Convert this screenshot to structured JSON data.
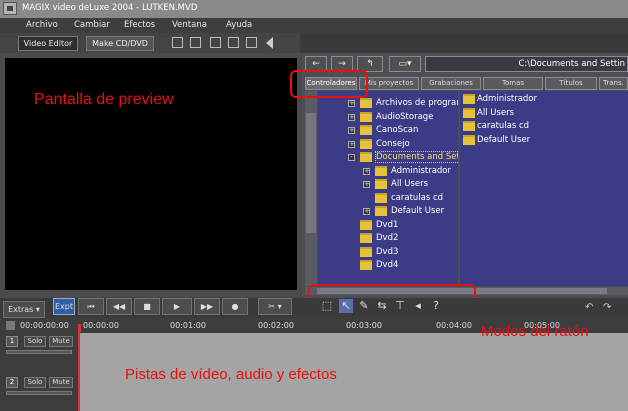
{
  "window": {
    "title": "MAGIX video deLuxe 2004 - LUTKEN.MVD"
  },
  "menu": [
    "Archivo",
    "Cambiar",
    "Efectos",
    "Ventana",
    "Ayuda"
  ],
  "toolbar": {
    "video_editor_tab": "Video Editor",
    "make_cd_tab": "Make CD/DVD"
  },
  "browser": {
    "path": "C:\\Documents and Settin",
    "tabs": [
      "Controladores",
      "Mis proyectos",
      "Grabaciones",
      "Tomas",
      "Títulos",
      "Trans."
    ],
    "tree": [
      {
        "label": "Archivos de program",
        "level": 1,
        "expander": "+"
      },
      {
        "label": "AudioStorage",
        "level": 1,
        "expander": "+"
      },
      {
        "label": "CanoScan",
        "level": 1,
        "expander": "+"
      },
      {
        "label": "Consejo",
        "level": 1,
        "expander": "+"
      },
      {
        "label": "Documents and Sett",
        "level": 1,
        "expander": "-",
        "selected": true
      },
      {
        "label": "Administrador",
        "level": 2,
        "expander": "+"
      },
      {
        "label": "All Users",
        "level": 2,
        "expander": "+"
      },
      {
        "label": "caratulas cd",
        "level": 2,
        "expander": ""
      },
      {
        "label": "Default User",
        "level": 2,
        "expander": "+"
      },
      {
        "label": "Dvd1",
        "level": 1,
        "expander": ""
      },
      {
        "label": "Dvd2",
        "level": 1,
        "expander": ""
      },
      {
        "label": "Dvd3",
        "level": 1,
        "expander": ""
      },
      {
        "label": "Dvd4",
        "level": 1,
        "expander": ""
      }
    ],
    "files": [
      "Administrador",
      "All Users",
      "caratulas cd",
      "Default User"
    ]
  },
  "transport": {
    "extras": "Extras",
    "expert": "Expt"
  },
  "timeline": {
    "time_display": "00:00:00:00",
    "ticks": [
      "00:00:00",
      "00:01:00",
      "00:02:00",
      "00:03:00",
      "00:04:00",
      "00:05:00"
    ],
    "tracks": [
      {
        "number": "1",
        "solo": "Solo",
        "mute": "Mute"
      },
      {
        "number": "2",
        "solo": "Solo",
        "mute": "Mute"
      }
    ]
  },
  "annotations": {
    "preview": "Pantalla de preview",
    "mouse_modes": "Modos del ratón",
    "tracks": "Pistas de vídeo, audio y efectos"
  },
  "colors": {
    "annotation_red": "#e81010",
    "folder_yellow": "#e6c23c",
    "tree_bg": "#3b3b86"
  }
}
